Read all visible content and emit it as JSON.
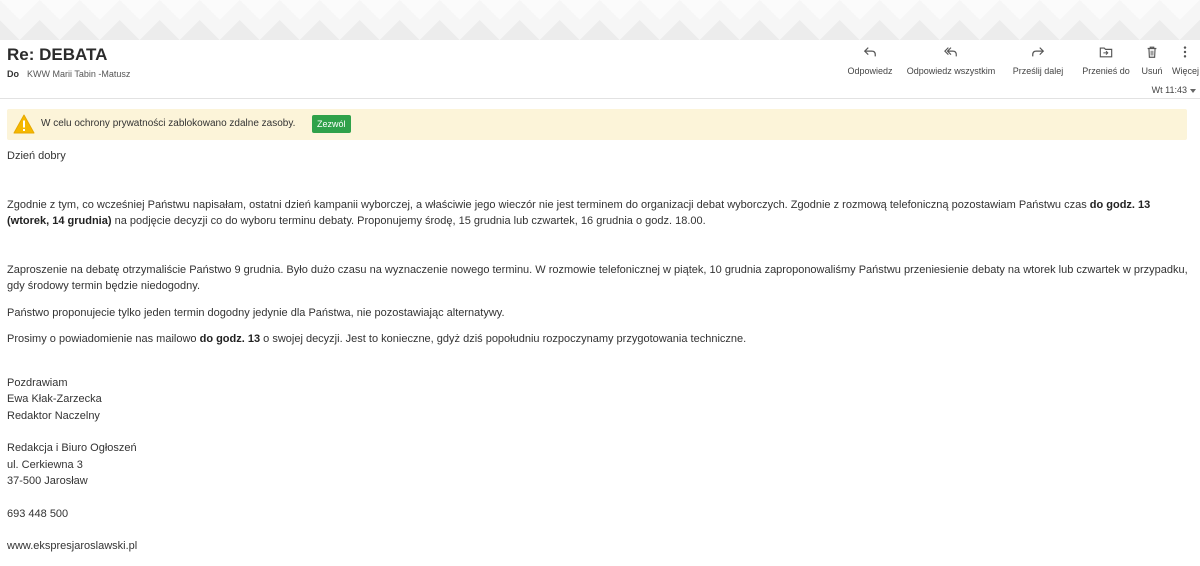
{
  "email": {
    "subject": "Re: DEBATA",
    "to_label": "Do",
    "to_value": "KWW Marii Tabin -Matusz",
    "timestamp": "Wt 11:43"
  },
  "toolbar": {
    "reply": "Odpowiedz",
    "reply_all": "Odpowiedz wszystkim",
    "forward": "Prześlij dalej",
    "move": "Przenieś do",
    "delete": "Usuń",
    "more": "Więcej"
  },
  "privacy_banner": {
    "text": "W celu ochrony prywatności zablokowano zdalne zasoby.",
    "allow": "Zezwól"
  },
  "message": {
    "greeting": "Dzień dobry",
    "p1_a": "Zgodnie z tym, co wcześniej Państwu napisałam, ostatni dzień kampanii wyborczej, a właściwie jego wieczór nie jest terminem do organizacji debat wyborczych. Zgodnie z rozmową telefoniczną pozostawiam Państwu czas ",
    "p1_bold": "do godz. 13 (wtorek, 14 grudnia)",
    "p1_b": " na podjęcie decyzji co do wyboru terminu debaty. Proponujemy środę, 15 grudnia lub czwartek, 16 grudnia o godz. 18.00.",
    "p2": "Zaproszenie na debatę otrzymaliście Państwo 9 grudnia. Było dużo czasu na wyznaczenie nowego terminu. W rozmowie telefonicznej w piątek, 10 grudnia zaproponowaliśmy Państwu przeniesienie debaty na wtorek lub czwartek w przypadku, gdy środowy termin będzie niedogodny.",
    "p3": "Państwo proponujecie tylko jeden termin dogodny jedynie dla Państwa, nie pozostawiając alternatywy.",
    "p4_a": "Prosimy o powiadomienie nas mailowo ",
    "p4_bold": "do godz. 13",
    "p4_b": " o swojej decyzji. Jest to konieczne, gdyż dziś popołudniu rozpoczynamy przygotowania techniczne.",
    "sign_greeting": "Pozdrawiam",
    "sign_name": "Ewa Kłak-Zarzecka",
    "sign_title": "Redaktor Naczelny",
    "org": "Redakcja i Biuro Ogłoszeń",
    "street": "ul. Cerkiewna 3",
    "city": "37-500 Jarosław",
    "phone": "693 448 500",
    "website": "www.ekspresjaroslawski.pl"
  }
}
